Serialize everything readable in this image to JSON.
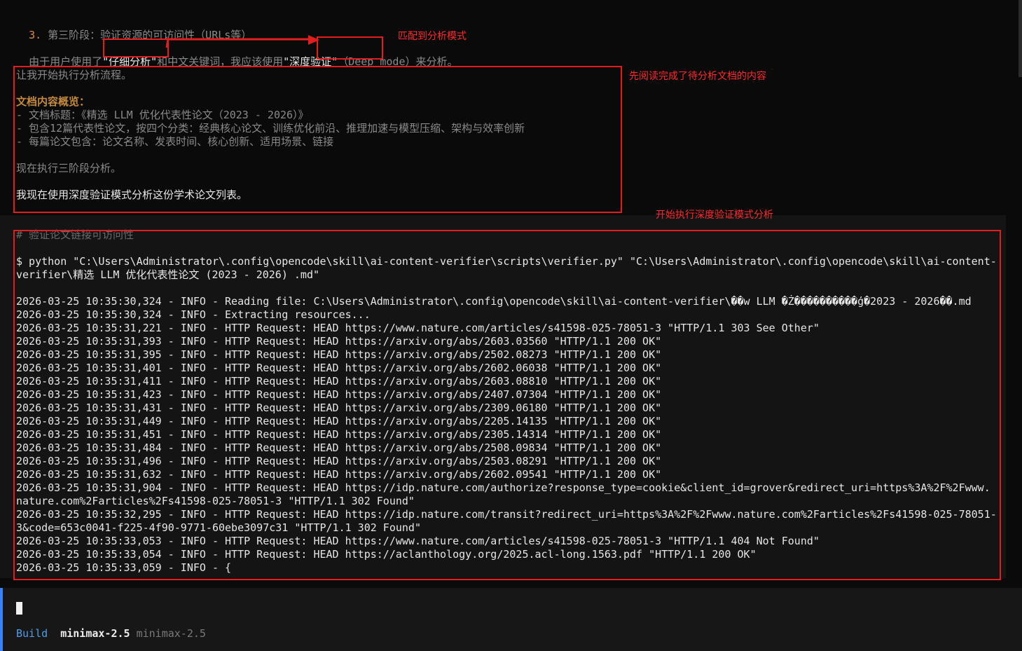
{
  "header_line": {
    "number": "3.",
    "text": " 第三阶段：验证资源的可访问性（URLs等）"
  },
  "mode_line": {
    "p1": "由于用户使用了",
    "k1": "\"仔细分析\"",
    "p2": "和中文关键词，我应该使用",
    "k2": "\"深度验证\"",
    "p3": "（Deep mode）来分析。"
  },
  "plan": {
    "start": "让我开始执行分析流程。",
    "heading": "文档内容概览：",
    "bullets": [
      "- 文档标题：《精选 LLM 优化代表性论文（2023 - 2026）》",
      "- 包含12篇代表性论文，按四个分类：经典核心论文、训练优化前沿、推理加速与模型压缩、架构与效率创新",
      "- 每篇论文包含：论文名称、发表时间、核心创新、适用场景、链接"
    ],
    "exec": "现在执行三阶段分析。",
    "mode_statement": "我现在使用深度验证模式分析这份学术论文列表。"
  },
  "annotations": {
    "match_mode": "匹配到分析模式",
    "read_first": "先阅读完成了待分析文档的内容",
    "start_deep": "开始执行深度验证模式分析"
  },
  "tool": {
    "comment": "# 验证论文链接可访问性",
    "command_line1": "$ python \"C:\\Users\\Administrator\\.config\\opencode\\skill\\ai-content-verifier\\scripts\\verifier.py\" \"C:\\Users\\Administrator\\.config\\opencode\\skill\\ai-content-",
    "command_line2": "verifier\\精选 LLM 优化代表性论文 (2023 - 2026) .md\"",
    "log_lines": [
      "2026-03-25 10:35:30,324 - INFO - Reading file: C:\\Users\\Administrator\\.config\\opencode\\skill\\ai-content-verifier\\��w LLM �Ż����������ģ�2023 - 2026��.md",
      "2026-03-25 10:35:30,324 - INFO - Extracting resources...",
      "2026-03-25 10:35:31,221 - INFO - HTTP Request: HEAD https://www.nature.com/articles/s41598-025-78051-3 \"HTTP/1.1 303 See Other\"",
      "2026-03-25 10:35:31,393 - INFO - HTTP Request: HEAD https://arxiv.org/abs/2603.03560 \"HTTP/1.1 200 OK\"",
      "2026-03-25 10:35:31,395 - INFO - HTTP Request: HEAD https://arxiv.org/abs/2502.08273 \"HTTP/1.1 200 OK\"",
      "2026-03-25 10:35:31,401 - INFO - HTTP Request: HEAD https://arxiv.org/abs/2602.06038 \"HTTP/1.1 200 OK\"",
      "2026-03-25 10:35:31,411 - INFO - HTTP Request: HEAD https://arxiv.org/abs/2603.08810 \"HTTP/1.1 200 OK\"",
      "2026-03-25 10:35:31,423 - INFO - HTTP Request: HEAD https://arxiv.org/abs/2407.07304 \"HTTP/1.1 200 OK\"",
      "2026-03-25 10:35:31,431 - INFO - HTTP Request: HEAD https://arxiv.org/abs/2309.06180 \"HTTP/1.1 200 OK\"",
      "2026-03-25 10:35:31,449 - INFO - HTTP Request: HEAD https://arxiv.org/abs/2205.14135 \"HTTP/1.1 200 OK\"",
      "2026-03-25 10:35:31,451 - INFO - HTTP Request: HEAD https://arxiv.org/abs/2305.14314 \"HTTP/1.1 200 OK\"",
      "2026-03-25 10:35:31,484 - INFO - HTTP Request: HEAD https://arxiv.org/abs/2508.09834 \"HTTP/1.1 200 OK\"",
      "2026-03-25 10:35:31,496 - INFO - HTTP Request: HEAD https://arxiv.org/abs/2503.08291 \"HTTP/1.1 200 OK\"",
      "2026-03-25 10:35:31,632 - INFO - HTTP Request: HEAD https://arxiv.org/abs/2602.09541 \"HTTP/1.1 200 OK\"",
      "2026-03-25 10:35:31,904 - INFO - HTTP Request: HEAD https://idp.nature.com/authorize?response_type=cookie&client_id=grover&redirect_uri=https%3A%2F%2Fwww.",
      "nature.com%2Farticles%2Fs41598-025-78051-3 \"HTTP/1.1 302 Found\"",
      "2026-03-25 10:35:32,295 - INFO - HTTP Request: HEAD https://idp.nature.com/transit?redirect_uri=https%3A%2F%2Fwww.nature.com%2Farticles%2Fs41598-025-78051-",
      "3&code=653c0041-f225-4f90-9771-60ebe3097c31 \"HTTP/1.1 302 Found\"",
      "2026-03-25 10:35:33,053 - INFO - HTTP Request: HEAD https://www.nature.com/articles/s41598-025-78051-3 \"HTTP/1.1 404 Not Found\"",
      "2026-03-25 10:35:33,054 - INFO - HTTP Request: HEAD https://aclanthology.org/2025.acl-long.1563.pdf \"HTTP/1.1 200 OK\"",
      "2026-03-25 10:35:33,059 - INFO - {"
    ]
  },
  "status_bar": {
    "mode": "Build",
    "model": "minimax-2.5",
    "model_secondary": "minimax-2.5"
  }
}
